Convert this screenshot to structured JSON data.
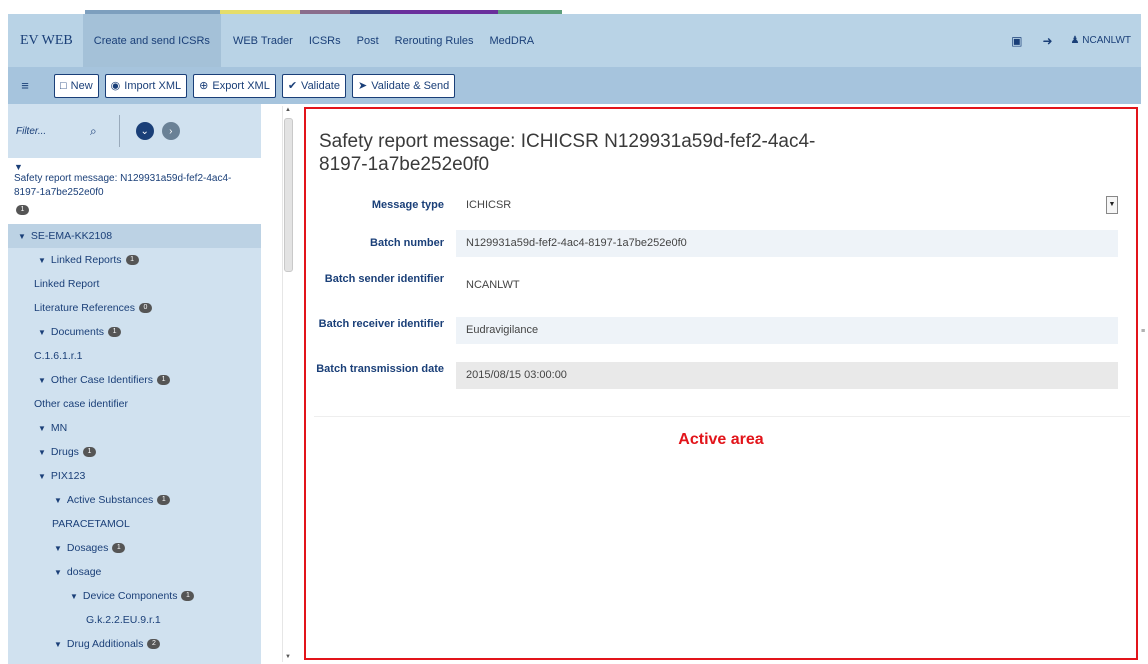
{
  "nav": {
    "brand": "EV WEB",
    "items": [
      "Create and send ICSRs",
      "WEB Trader",
      "ICSRs",
      "Post",
      "Rerouting Rules",
      "MedDRA"
    ],
    "user": "NCANLWT",
    "colorbar": [
      "#7d9fbe",
      "#e5dd6b",
      "#8a6d8c",
      "#3d4a8a",
      "#6a2f9c",
      "#5d9f7b"
    ]
  },
  "toolbar": {
    "menu_icon": "hamburger-icon",
    "buttons": [
      {
        "label": "New",
        "icon": "file-icon"
      },
      {
        "label": "Import XML",
        "icon": "import-icon"
      },
      {
        "label": "Export XML",
        "icon": "export-icon"
      },
      {
        "label": "Validate",
        "icon": "check-icon"
      },
      {
        "label": "Validate & Send",
        "icon": "send-icon"
      }
    ]
  },
  "sidebar": {
    "filter_placeholder": "Filter...",
    "root": {
      "title": "Safety report message: N129931a59d-fef2-4ac4-8197-1a7be252e0f0",
      "badge": "1"
    },
    "tree": [
      {
        "label": "SE-EMA-KK2108",
        "indent": 0,
        "chevron": true,
        "badge": null
      },
      {
        "label": "Linked Reports",
        "indent": 1,
        "chevron": true,
        "badge": "1"
      },
      {
        "label": "Linked Report",
        "indent": 1,
        "chevron": false,
        "badge": null
      },
      {
        "label": "Literature References",
        "indent": 0,
        "chevron": false,
        "badge": "0"
      },
      {
        "label": "Documents",
        "indent": 1,
        "chevron": true,
        "badge": "1"
      },
      {
        "label": "C.1.6.1.r.1",
        "indent": 1,
        "chevron": false,
        "badge": null
      },
      {
        "label": "Other Case Identifiers",
        "indent": 1,
        "chevron": true,
        "badge": "1"
      },
      {
        "label": "Other case identifier",
        "indent": 1,
        "chevron": false,
        "badge": null
      },
      {
        "label": "MN",
        "indent": 1,
        "chevron": true,
        "badge": null
      },
      {
        "label": "Drugs",
        "indent": 2,
        "chevron": true,
        "badge": "1"
      },
      {
        "label": "PIX123",
        "indent": 3,
        "chevron": true,
        "badge": null
      },
      {
        "label": "Active Substances",
        "indent": 4,
        "chevron": true,
        "badge": "1"
      },
      {
        "label": "PARACETAMOL",
        "indent": 4,
        "chevron": false,
        "badge": null
      },
      {
        "label": "Dosages",
        "indent": 4,
        "chevron": true,
        "badge": "1"
      },
      {
        "label": "dosage",
        "indent": 5,
        "chevron": true,
        "badge": null
      },
      {
        "label": "Device Components",
        "indent": 6,
        "chevron": true,
        "badge": "1"
      },
      {
        "label": "G.k.2.2.EU.9.r.1",
        "indent": 6,
        "chevron": false,
        "badge": null
      },
      {
        "label": "Drug Additionals",
        "indent": 4,
        "chevron": true,
        "badge": "2"
      }
    ]
  },
  "main": {
    "title": "Safety report message: ICHICSR N129931a59d-fef2-4ac4-8197-1a7be252e0f0",
    "fields": [
      {
        "label": "Message type",
        "value": "ICHICSR",
        "kind": "select"
      },
      {
        "label": "Batch number",
        "value": "N129931a59d-fef2-4ac4-8197-1a7be252e0f0",
        "kind": "shade"
      },
      {
        "label": "Batch sender identifier",
        "value": "NCANLWT",
        "kind": "plain"
      },
      {
        "label": "Batch receiver identifier",
        "value": "Eudravigilance",
        "kind": "shade"
      },
      {
        "label": "Batch transmission date",
        "value": "2015/08/15 03:00:00",
        "kind": "gray"
      }
    ],
    "active_area_label": "Active area"
  }
}
